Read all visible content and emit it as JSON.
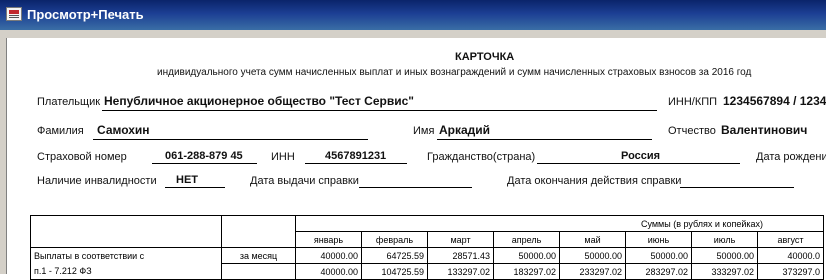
{
  "window": {
    "title": "Просмотр+Печать"
  },
  "card": {
    "title": "КАРТОЧКА",
    "subtitle": "индивидуального учета сумм начисленных выплат и иных вознаграждений и сумм начисленных страховых взносов за 2016 год"
  },
  "payer": {
    "label": "Плательщик",
    "value": "Непубличное акционерное общество \"Тест Сервис\""
  },
  "inn_kpp": {
    "label": "ИНН/КПП",
    "value": "1234567894 / 1234"
  },
  "surname": {
    "label": "Фамилия",
    "value": "Самохин"
  },
  "name": {
    "label": "Имя",
    "value": "Аркадий"
  },
  "patronymic": {
    "label": "Отчество",
    "value": "Валентинович"
  },
  "insurance_number": {
    "label": "Страховой номер",
    "value": "061-288-879 45"
  },
  "inn": {
    "label": "ИНН",
    "value": "4567891231"
  },
  "citizenship": {
    "label": "Гражданство(страна)",
    "value": "Россия"
  },
  "birth_date": {
    "label": "Дата рождени"
  },
  "disability": {
    "label": "Наличие инвалидности",
    "value": "НЕТ"
  },
  "cert_issue_date": {
    "label": "Дата выдачи справки"
  },
  "cert_end_date": {
    "label": "Дата окончания действия справки"
  },
  "table": {
    "sums_header": "Суммы (в рублях и копейках)",
    "months": [
      "январь",
      "февраль",
      "март",
      "апрель",
      "май",
      "июнь",
      "июль",
      "август"
    ],
    "row1": {
      "label": "Выплаты в соответствии с",
      "period": "за месяц",
      "values": [
        "40000.00",
        "64725.59",
        "28571.43",
        "50000.00",
        "50000.00",
        "50000.00",
        "50000.00",
        "40000.0"
      ]
    },
    "row2": {
      "label": "п.1 - 7.212 ФЗ",
      "values": [
        "40000.00",
        "104725.59",
        "133297.02",
        "183297.02",
        "233297.02",
        "283297.02",
        "333297.02",
        "373297.0"
      ]
    }
  }
}
